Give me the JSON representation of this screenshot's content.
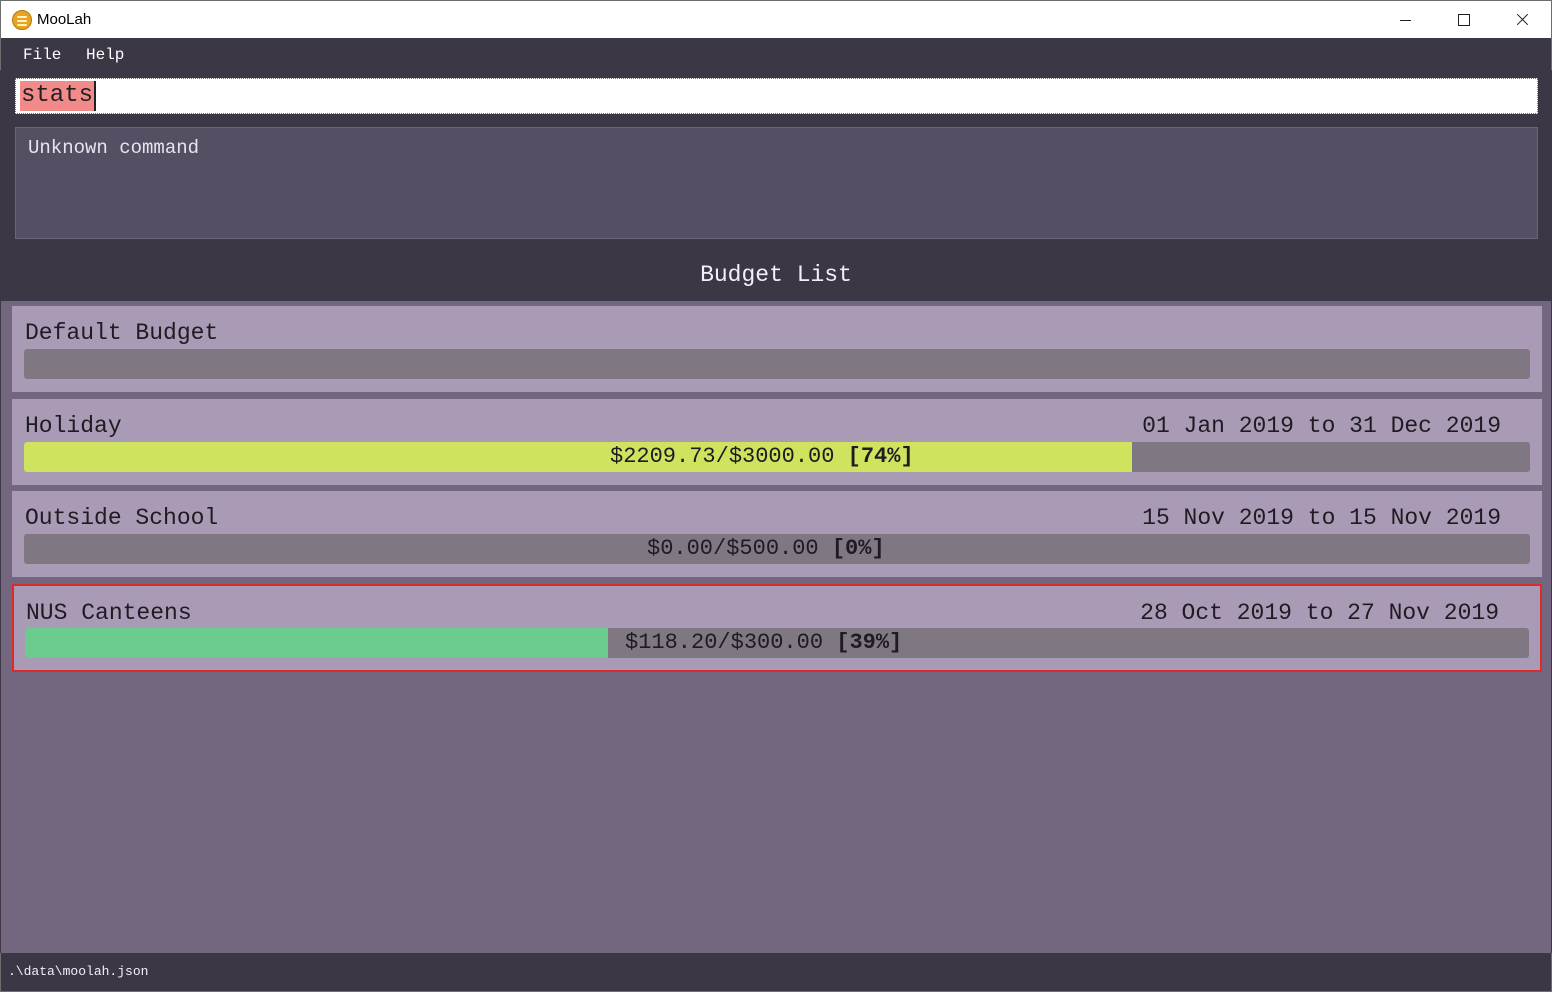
{
  "window": {
    "title": "MooLah"
  },
  "menu": {
    "file": "File",
    "help": "Help"
  },
  "command": {
    "value": "stats"
  },
  "result": {
    "text": "Unknown command"
  },
  "panel": {
    "title": "Budget List"
  },
  "budgets": [
    {
      "name": "Default Budget",
      "period": "",
      "amount": "",
      "percent": "",
      "fraction": 0,
      "color": ""
    },
    {
      "name": "Holiday",
      "period": "01 Jan 2019 to 31 Dec 2019",
      "amount": "$2209.73/$3000.00",
      "percent": "[74%]",
      "fraction": 0.74,
      "color": "#cfe35f"
    },
    {
      "name": "Outside School",
      "period": "15 Nov 2019 to 15 Nov 2019",
      "amount": "$0.00/$500.00",
      "percent": "[0%]",
      "fraction": 0,
      "color": ""
    },
    {
      "name": "NUS Canteens",
      "period": "28 Oct 2019 to 27 Nov 2019",
      "amount": "$118.20/$300.00",
      "percent": "[39%]",
      "fraction": 0.39,
      "color": "#6ccb8e",
      "selected": true
    }
  ],
  "status": {
    "path": ".\\data\\moolah.json"
  }
}
